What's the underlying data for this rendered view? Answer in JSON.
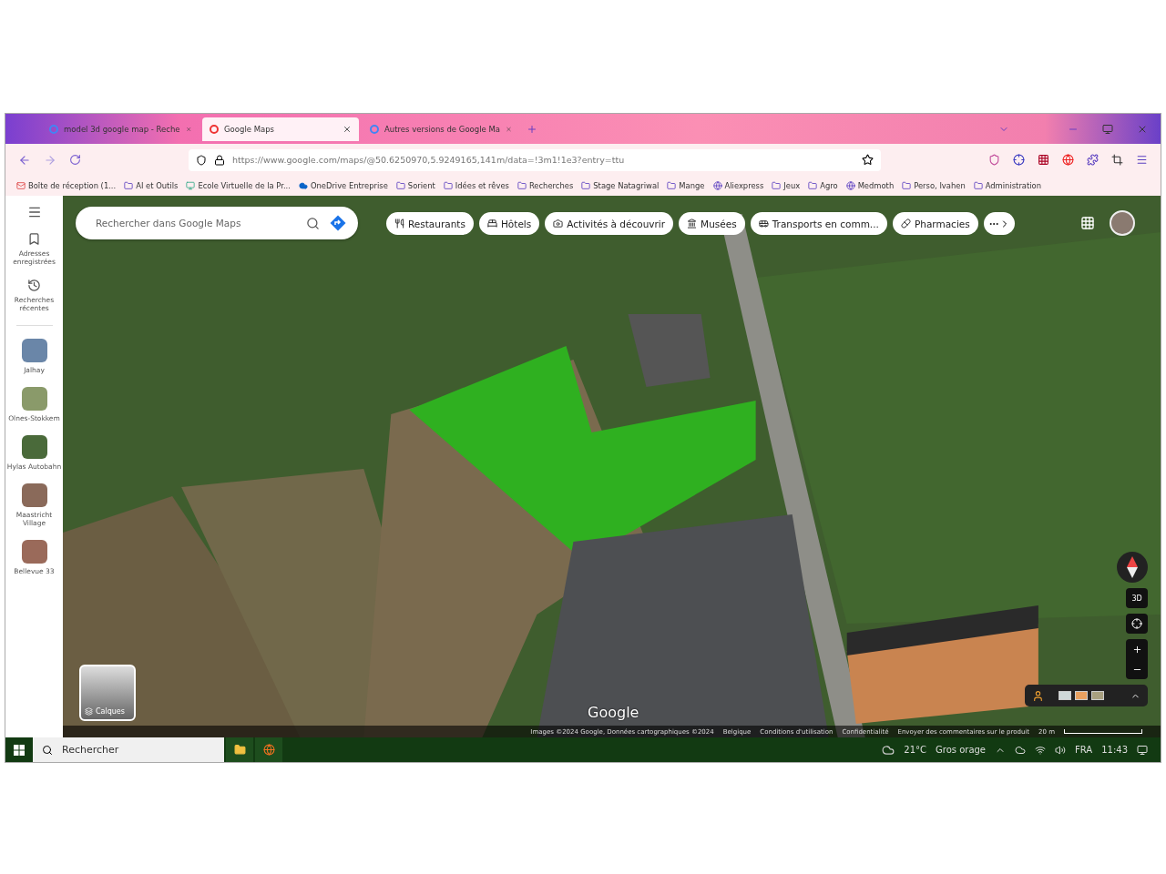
{
  "browser": {
    "tabs": [
      {
        "title": "model 3d google map - Reche",
        "kind": "google",
        "selected": false
      },
      {
        "title": "Google Maps",
        "kind": "maps",
        "selected": true
      },
      {
        "title": "Autres versions de Google Ma",
        "kind": "google",
        "selected": false
      }
    ],
    "url": "https://www.google.com/maps/@50.6250970,5.9249165,141m/data=!3m1!1e3?entry=ttu",
    "bookmarks": [
      {
        "label": "Boîte de réception (1...",
        "kind": "mail"
      },
      {
        "label": "AI et Outils",
        "kind": "folder"
      },
      {
        "label": "Ecole Virtuelle de la Pr...",
        "kind": "site"
      },
      {
        "label": "OneDrive Entreprise",
        "kind": "cloud"
      },
      {
        "label": "Sorient",
        "kind": "folder"
      },
      {
        "label": "Idées et rêves",
        "kind": "folder"
      },
      {
        "label": "Recherches",
        "kind": "folder"
      },
      {
        "label": "Stage Natagriwal",
        "kind": "folder"
      },
      {
        "label": "Mange",
        "kind": "folder"
      },
      {
        "label": "Aliexpress",
        "kind": "globe"
      },
      {
        "label": "Jeux",
        "kind": "folder"
      },
      {
        "label": "Agro",
        "kind": "folder"
      },
      {
        "label": "Medmoth",
        "kind": "globe"
      },
      {
        "label": "Perso, Ivahen",
        "kind": "folder"
      },
      {
        "label": "Administration",
        "kind": "folder"
      }
    ]
  },
  "sidebar": {
    "items": [
      {
        "label": "Adresses enregistrées",
        "kind": "saved"
      },
      {
        "label": "Recherches récentes",
        "kind": "history"
      }
    ],
    "places": [
      {
        "label": "Jalhay"
      },
      {
        "label": "Olnes-Stokkem"
      },
      {
        "label": "Hylas Autobahn"
      },
      {
        "label": "Maastricht Village"
      },
      {
        "label": "Bellevue 33"
      }
    ]
  },
  "search": {
    "placeholder": "Rechercher dans Google Maps"
  },
  "chips": [
    {
      "label": "Restaurants",
      "kind": "restaurant"
    },
    {
      "label": "Hôtels",
      "kind": "hotel"
    },
    {
      "label": "Activités à découvrir",
      "kind": "camera"
    },
    {
      "label": "Musées",
      "kind": "museum"
    },
    {
      "label": "Transports en comm...",
      "kind": "transit"
    },
    {
      "label": "Pharmacies",
      "kind": "pharmacy"
    }
  ],
  "layers_button": {
    "label": "Calques"
  },
  "map": {
    "logo": "Google",
    "view_3d": "3D",
    "footer": [
      "Images ©2024 Google, Données cartographiques ©2024",
      "Belgique",
      "Conditions d'utilisation",
      "Confidentialité",
      "Envoyer des commentaires sur le produit"
    ],
    "scale": "20 m"
  },
  "taskbar": {
    "search_placeholder": "Rechercher",
    "temperature": "21°C",
    "weather": "Gros orage",
    "language": "FRA",
    "time": "11:43"
  }
}
